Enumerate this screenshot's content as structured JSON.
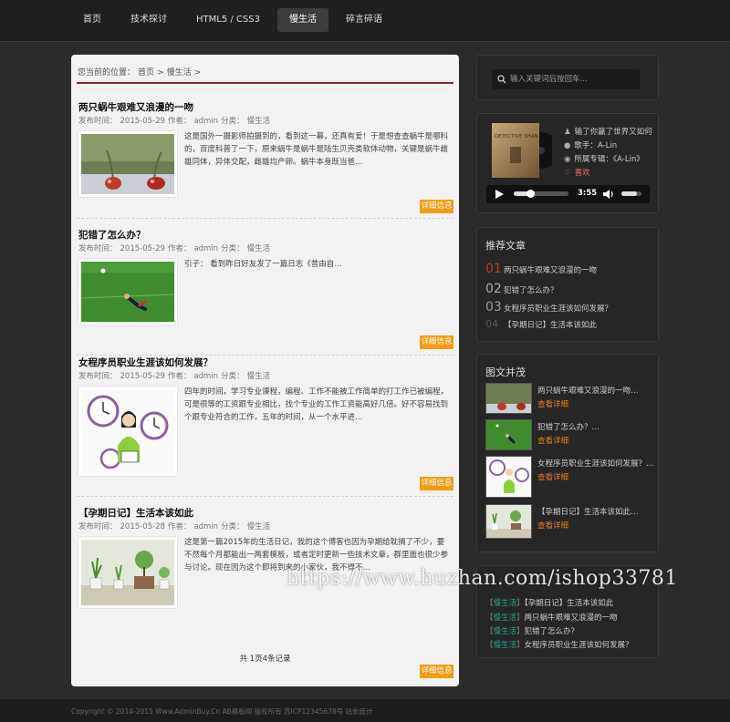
{
  "nav": {
    "items": [
      {
        "label": "首页"
      },
      {
        "label": "技术探讨"
      },
      {
        "label": "HTML5 / CSS3"
      },
      {
        "label": "慢生活"
      },
      {
        "label": "碎言碎语"
      }
    ],
    "active_index": 3
  },
  "breadcrumb": {
    "prefix": "您当前的位置：",
    "home": "首页",
    "sep": ">",
    "current": "慢生活",
    "end": ">"
  },
  "posts": [
    {
      "title": "两只蜗牛艰难又浪漫的一吻",
      "date_label": "发布时间：",
      "date": "2015-05-29",
      "author_label": "作者：",
      "author": "admin",
      "category_label": "分类：",
      "category": "慢生活",
      "excerpt": "这是国外一摄影师拍摄到的，看到这一幕，还真有爱！于是想查查蜗牛是哪科的，百度科普了一下，原来蜗牛是蜗牛是陆生贝壳类软体动物，关键是蜗牛雌雄同体，异体交配，雌雄均产卵。蜗牛本身既当爸…",
      "more": "详细信息",
      "thumb_icon": "snail-photo-icon"
    },
    {
      "title": "犯错了怎么办？",
      "date_label": "发布时间：",
      "date": "2015-05-29",
      "author_label": "作者：",
      "author": "admin",
      "category_label": "分类：",
      "category": "慢生活",
      "excerpt": "引子：  看到昨日好友发了一篇日志《昔由自…",
      "more": "详细信息",
      "thumb_icon": "soccer-photo-icon"
    },
    {
      "title": "女程序员职业生涯该如何发展？",
      "date_label": "发布时间：",
      "date": "2015-05-29",
      "author_label": "作者：",
      "author": "admin",
      "category_label": "分类：",
      "category": "慢生活",
      "excerpt": "四年的时间，学习专业课程，编程、工作不能被工作简单的打工作已被编程，可是很等的工资跟专业相比，找个专业的工作工资能高好几倍。好不容易找到个跟专业符合的工作，五年的时间，从一个水平进…",
      "more": "详细信息",
      "thumb_icon": "woman-clock-illustration-icon"
    },
    {
      "title": "【孕期日记】生活本该如此",
      "date_label": "发布时间：",
      "date": "2015-05-28",
      "author_label": "作者：",
      "author": "admin",
      "category_label": "分类：",
      "category": "慢生活",
      "excerpt": "这是第一篇2015年的生活日记，我的这个博客也因为孕期给耽搁了不少，要不然每个月都能出一两套模板，或者定时更新一些技术文章，群里面也很少参与讨论。现在因为这个即将到来的小家伙，我不得不…",
      "more": "详细信息",
      "thumb_icon": "plants-photo-icon"
    }
  ],
  "pager": {
    "text": "共 1页4条记录"
  },
  "search": {
    "placeholder": "输入关键词后按回车..."
  },
  "player": {
    "song": "输了你赢了世界又如何",
    "singer": "歌手：A-Lin",
    "album": "所属专辑：《A-Lin》",
    "like": "喜欢",
    "time": "3:55",
    "progress": 0.3,
    "volume": 0.75,
    "cover_text": "DETECTIVE SHAN"
  },
  "recommend": {
    "title": "推荐文章",
    "items": [
      {
        "num": "01",
        "text": "两只蜗牛艰难又浪漫的一吻"
      },
      {
        "num": "02",
        "text": "犯错了怎么办？"
      },
      {
        "num": "03",
        "text": "女程序员职业生涯该如何发展？"
      },
      {
        "num": "04",
        "text": "【孕期日记】生活本该如此"
      }
    ]
  },
  "gallery": {
    "title": "图文并茂",
    "items": [
      {
        "title": "两只蜗牛艰难又浪漫的一吻…",
        "more": "查看详细"
      },
      {
        "title": "犯错了怎么办？…",
        "more": "查看详细"
      },
      {
        "title": "女程序员职业生涯该如何发展？…",
        "more": "查看详细"
      },
      {
        "title": "【孕期日记】生活本该如此…",
        "more": "查看详细"
      }
    ]
  },
  "category_list": {
    "items": [
      {
        "cat": "慢生活",
        "title": "【孕期日记】生活本该如此"
      },
      {
        "cat": "慢生活",
        "title": "两只蜗牛艰难又浪漫的一吻"
      },
      {
        "cat": "慢生活",
        "title": "犯错了怎么办？"
      },
      {
        "cat": "慢生活",
        "title": "女程序员职业生涯该如何发展？"
      }
    ],
    "bracket_open": "【",
    "bracket_close": "】"
  },
  "footer": {
    "text": "Copyright © 2014-2015 Www.AdminBuy.Cn AB模板网 版权所有 苏ICP12345678号 站长统计"
  },
  "watermark": {
    "text": "https://www.huzhan.com/ishop33781"
  },
  "colors": {
    "accent": "#f39c12",
    "breadcrumb_line": "#8b2a1e",
    "category": "#2e9c8a",
    "recommend_first": "#c0392b"
  }
}
